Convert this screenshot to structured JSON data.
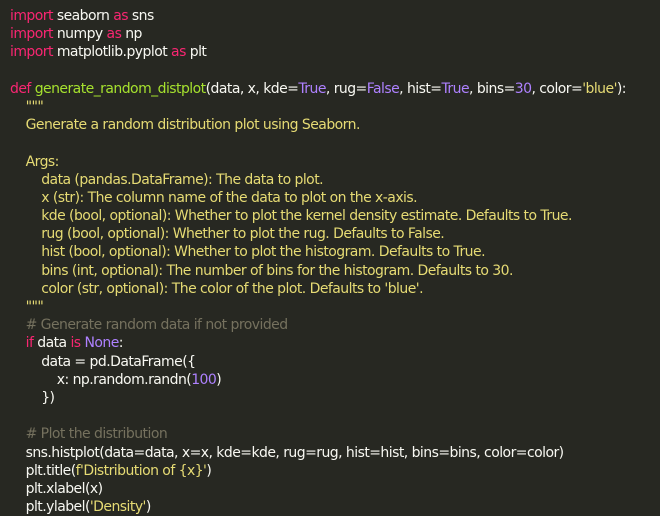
{
  "code": {
    "lines": [
      [
        {
          "t": "import",
          "c": "kw"
        },
        {
          "t": " seaborn ",
          "c": "plain"
        },
        {
          "t": "as",
          "c": "kw"
        },
        {
          "t": " sns",
          "c": "plain"
        }
      ],
      [
        {
          "t": "import",
          "c": "kw"
        },
        {
          "t": " numpy ",
          "c": "plain"
        },
        {
          "t": "as",
          "c": "kw"
        },
        {
          "t": " np",
          "c": "plain"
        }
      ],
      [
        {
          "t": "import",
          "c": "kw"
        },
        {
          "t": " matplotlib.pyplot ",
          "c": "plain"
        },
        {
          "t": "as",
          "c": "kw"
        },
        {
          "t": " plt",
          "c": "plain"
        }
      ],
      [],
      [
        {
          "t": "def",
          "c": "kw"
        },
        {
          "t": " ",
          "c": "plain"
        },
        {
          "t": "generate_random_distplot",
          "c": "fn"
        },
        {
          "t": "(data, x, kde=",
          "c": "plain"
        },
        {
          "t": "True",
          "c": "const"
        },
        {
          "t": ", rug=",
          "c": "plain"
        },
        {
          "t": "False",
          "c": "const"
        },
        {
          "t": ", hist=",
          "c": "plain"
        },
        {
          "t": "True",
          "c": "const"
        },
        {
          "t": ", bins=",
          "c": "plain"
        },
        {
          "t": "30",
          "c": "num"
        },
        {
          "t": ", color=",
          "c": "plain"
        },
        {
          "t": "'blue'",
          "c": "str"
        },
        {
          "t": "):",
          "c": "plain"
        }
      ],
      [
        {
          "t": "    \"\"\"",
          "c": "doc"
        }
      ],
      [
        {
          "t": "    Generate a random distribution plot using Seaborn.",
          "c": "doc"
        }
      ],
      [],
      [
        {
          "t": "    Args:",
          "c": "doc"
        }
      ],
      [
        {
          "t": "        data (pandas.DataFrame): The data to plot.",
          "c": "doc"
        }
      ],
      [
        {
          "t": "        x (str): The column name of the data to plot on the x-axis.",
          "c": "doc"
        }
      ],
      [
        {
          "t": "        kde (bool, optional): Whether to plot the kernel density estimate. Defaults to True.",
          "c": "doc"
        }
      ],
      [
        {
          "t": "        rug (bool, optional): Whether to plot the rug. Defaults to False.",
          "c": "doc"
        }
      ],
      [
        {
          "t": "        hist (bool, optional): Whether to plot the histogram. Defaults to True.",
          "c": "doc"
        }
      ],
      [
        {
          "t": "        bins (int, optional): The number of bins for the histogram. Defaults to 30.",
          "c": "doc"
        }
      ],
      [
        {
          "t": "        color (str, optional): The color of the plot. Defaults to 'blue'.",
          "c": "doc"
        }
      ],
      [
        {
          "t": "    \"\"\"",
          "c": "doc"
        }
      ],
      [
        {
          "t": "    # Generate random data if not provided",
          "c": "cmt"
        }
      ],
      [
        {
          "t": "    ",
          "c": "plain"
        },
        {
          "t": "if",
          "c": "kw"
        },
        {
          "t": " data ",
          "c": "plain"
        },
        {
          "t": "is",
          "c": "kw"
        },
        {
          "t": " ",
          "c": "plain"
        },
        {
          "t": "None",
          "c": "const"
        },
        {
          "t": ":",
          "c": "plain"
        }
      ],
      [
        {
          "t": "        data = pd.DataFrame({",
          "c": "plain"
        }
      ],
      [
        {
          "t": "            x: np.random.randn(",
          "c": "plain"
        },
        {
          "t": "100",
          "c": "num"
        },
        {
          "t": ")",
          "c": "plain"
        }
      ],
      [
        {
          "t": "        })",
          "c": "plain"
        }
      ],
      [],
      [
        {
          "t": "    # Plot the distribution",
          "c": "cmt"
        }
      ],
      [
        {
          "t": "    sns.histplot(data=data, x=x, kde=kde, rug=rug, hist=hist, bins=bins, color=color)",
          "c": "plain"
        }
      ],
      [
        {
          "t": "    plt.title(",
          "c": "plain"
        },
        {
          "t": "f'Distribution of {x}'",
          "c": "str"
        },
        {
          "t": ")",
          "c": "plain"
        }
      ],
      [
        {
          "t": "    plt.xlabel(x)",
          "c": "plain"
        }
      ],
      [
        {
          "t": "    plt.ylabel(",
          "c": "plain"
        },
        {
          "t": "'Density'",
          "c": "str"
        },
        {
          "t": ")",
          "c": "plain"
        }
      ]
    ]
  },
  "colors": {
    "background": "#272822",
    "keyword": "#f92672",
    "function": "#a6e22e",
    "string": "#e6db74",
    "number": "#ae81ff",
    "comment": "#75715e",
    "text": "#f8f8f2"
  }
}
